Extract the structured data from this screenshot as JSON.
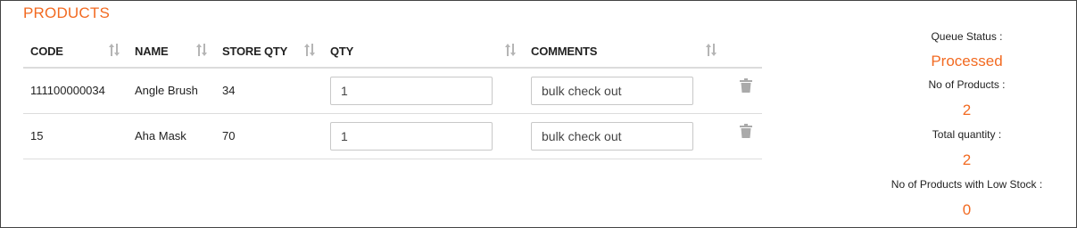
{
  "section_title": "PRODUCTS",
  "columns": [
    "CODE",
    "NAME",
    "STORE QTY",
    "QTY",
    "COMMENTS"
  ],
  "icons": {
    "sort": "sort-arrows-icon",
    "delete": "trash-icon"
  },
  "colors": {
    "accent": "#f26a21",
    "sort_icon": "#b5b5b5",
    "trash_icon": "#aaaaaa"
  },
  "rows": [
    {
      "code": "111100000034",
      "name": "Angle Brush",
      "store_qty": "34",
      "qty": "1",
      "comment": "bulk check out"
    },
    {
      "code": "15",
      "name": "Aha Mask",
      "store_qty": "70",
      "qty": "1",
      "comment": "bulk check out"
    }
  ],
  "summary": {
    "queue_status_label": "Queue Status :",
    "queue_status_value": "Processed",
    "products_label": "No of Products :",
    "products_value": "2",
    "total_qty_label": "Total quantity :",
    "total_qty_value": "2",
    "low_stock_label": "No of Products with Low Stock :",
    "low_stock_value": "0"
  }
}
